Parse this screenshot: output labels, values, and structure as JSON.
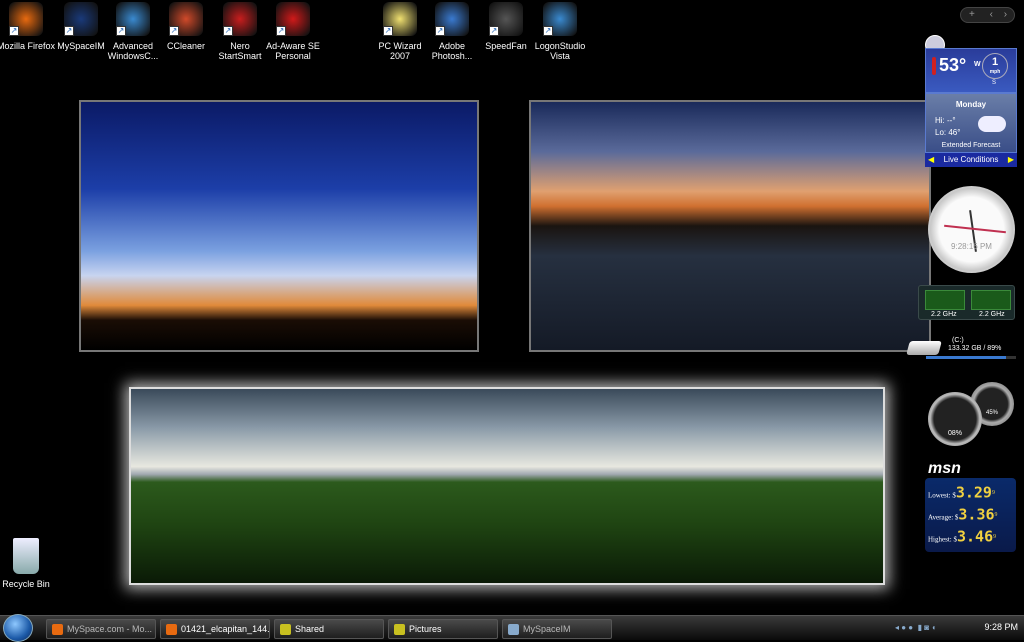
{
  "desktop_icons": [
    {
      "label": "Mozilla Firefox",
      "icon": "firefox-icon",
      "color": "#e86a10"
    },
    {
      "label": "MySpaceIM",
      "icon": "myspaceim-icon",
      "color": "#1a3a7a"
    },
    {
      "label": "Advanced WindowsC...",
      "icon": "advanced-windowscare-icon",
      "color": "#3a8ad0"
    },
    {
      "label": "CCleaner",
      "icon": "ccleaner-icon",
      "color": "#d04a2a"
    },
    {
      "label": "Nero StartSmart",
      "icon": "nero-icon",
      "color": "#c81e1e"
    },
    {
      "label": "Ad-Aware SE Personal",
      "icon": "adaware-icon",
      "color": "#d01a1a"
    },
    {
      "label": "PC Wizard 2007",
      "icon": "pcwizard-icon",
      "color": "#f0e070"
    },
    {
      "label": "Adobe Photosh...",
      "icon": "photoshop-icon",
      "color": "#3a7ad0"
    },
    {
      "label": "SpeedFan",
      "icon": "speedfan-icon",
      "color": "#555555"
    },
    {
      "label": "LogonStudio Vista",
      "icon": "logonstudio-icon",
      "color": "#3a8ad0"
    }
  ],
  "recycle_bin": {
    "label": "Recycle Bin"
  },
  "sidebar": {
    "weather": {
      "temp": "53°",
      "wind_dir": "W",
      "wind_speed": "1",
      "wind_unit": "mph",
      "south": "S",
      "day": "Monday",
      "hi": "Hi: --°",
      "lo": "Lo: 46°",
      "extended": "Extended Forecast",
      "live": "Live Conditions"
    },
    "clock": {
      "time": "9:28:16 PM"
    },
    "cpu": {
      "core1": "2.2 GHz",
      "core2": "2.2 GHz"
    },
    "drive": {
      "label": "(C:)",
      "usage": "133.32 GB / 89%",
      "fill_percent": 89
    },
    "meters": {
      "cpu": "08%",
      "ram": "45%"
    },
    "msn": {
      "logo": "msn",
      "rows": [
        {
          "label": "Lowest:",
          "value": "3.29",
          "sup": "9"
        },
        {
          "label": "Average:",
          "value": "3.36",
          "sup": "9"
        },
        {
          "label": "Highest:",
          "value": "3.46",
          "sup": "9"
        }
      ]
    }
  },
  "taskbar": {
    "buttons": [
      {
        "label": "MySpace.com - Mo...",
        "blurred": true
      },
      {
        "label": "01421_elcapitan_144..."
      },
      {
        "label": "Shared"
      },
      {
        "label": "Pictures"
      },
      {
        "label": "MySpaceIM",
        "blurred": true
      }
    ],
    "time": "9:28 PM"
  }
}
